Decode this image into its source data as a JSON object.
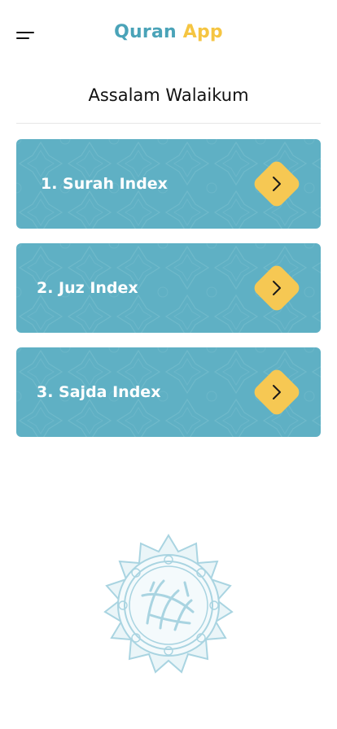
{
  "header": {
    "title_part1": "Quran",
    "title_part2": "App",
    "title_color1": "#4aa3b8",
    "title_color2": "#f5c542",
    "menu_icon": "hamburger-menu-icon"
  },
  "greeting": "Assalam Walaikum",
  "menu": {
    "card_color": "#5fb0c4",
    "button_color": "#f6c853",
    "items": [
      {
        "label": "1. Surah Index",
        "icon": "chevron-right-icon"
      },
      {
        "label": "2. Juz Index",
        "icon": "chevron-right-icon"
      },
      {
        "label": "3. Sajda Index",
        "icon": "chevron-right-icon"
      }
    ]
  },
  "emblem": {
    "icon": "quran-calligraphy-emblem",
    "color": "#a9d4e1"
  }
}
